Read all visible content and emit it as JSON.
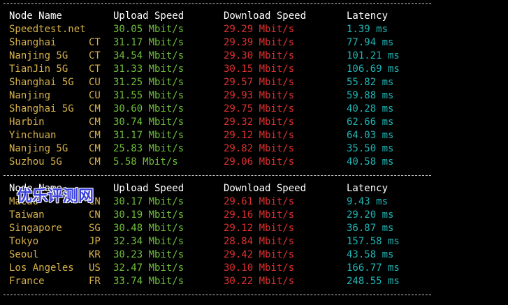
{
  "headers": {
    "name": "Node Name",
    "upload": "Upload Speed",
    "download": "Download Speed",
    "latency": "Latency"
  },
  "separator": "--------------------------------------------------------------------------------",
  "block1": [
    {
      "name": "Speedtest.net",
      "isp": "",
      "upload": "30.05 Mbit/s",
      "download": "29.29 Mbit/s",
      "latency": "1.39 ms"
    },
    {
      "name": "Shanghai",
      "isp": "CT",
      "upload": "31.17 Mbit/s",
      "download": "29.39 Mbit/s",
      "latency": "77.94 ms"
    },
    {
      "name": "Nanjing 5G",
      "isp": "CT",
      "upload": "34.54 Mbit/s",
      "download": "29.30 Mbit/s",
      "latency": "101.21 ms"
    },
    {
      "name": "TianJin 5G",
      "isp": "CT",
      "upload": "31.33 Mbit/s",
      "download": "30.15 Mbit/s",
      "latency": "106.69 ms"
    },
    {
      "name": "Shanghai 5G",
      "isp": "CU",
      "upload": "31.25 Mbit/s",
      "download": "29.57 Mbit/s",
      "latency": "55.82 ms"
    },
    {
      "name": "Nanjing",
      "isp": "CU",
      "upload": "31.55 Mbit/s",
      "download": "29.93 Mbit/s",
      "latency": "59.88 ms"
    },
    {
      "name": "Shanghai 5G",
      "isp": "CM",
      "upload": "30.60 Mbit/s",
      "download": "29.75 Mbit/s",
      "latency": "40.28 ms"
    },
    {
      "name": "Harbin",
      "isp": "CM",
      "upload": "30.74 Mbit/s",
      "download": "29.32 Mbit/s",
      "latency": "62.66 ms"
    },
    {
      "name": "Yinchuan",
      "isp": "CM",
      "upload": "31.17 Mbit/s",
      "download": "29.12 Mbit/s",
      "latency": "64.03 ms"
    },
    {
      "name": "Nanjing 5G",
      "isp": "CM",
      "upload": "25.83 Mbit/s",
      "download": "29.82 Mbit/s",
      "latency": "35.50 ms"
    },
    {
      "name": "Suzhou 5G",
      "isp": "CM",
      "upload": "5.58 Mbit/s",
      "download": "29.06 Mbit/s",
      "latency": "40.58 ms"
    }
  ],
  "block2": [
    {
      "name": "Macao",
      "isp": "CN",
      "upload": "30.17 Mbit/s",
      "download": "29.61 Mbit/s",
      "latency": "9.43 ms"
    },
    {
      "name": "Taiwan",
      "isp": "CN",
      "upload": "30.19 Mbit/s",
      "download": "29.16 Mbit/s",
      "latency": "29.20 ms"
    },
    {
      "name": "Singapore",
      "isp": "SG",
      "upload": "30.48 Mbit/s",
      "download": "29.12 Mbit/s",
      "latency": "36.87 ms"
    },
    {
      "name": "Tokyo",
      "isp": "JP",
      "upload": "32.34 Mbit/s",
      "download": "28.84 Mbit/s",
      "latency": "157.58 ms"
    },
    {
      "name": "Seoul",
      "isp": "KR",
      "upload": "30.23 Mbit/s",
      "download": "29.42 Mbit/s",
      "latency": "43.58 ms"
    },
    {
      "name": "Los Angeles",
      "isp": "US",
      "upload": "32.47 Mbit/s",
      "download": "30.10 Mbit/s",
      "latency": "166.77 ms"
    },
    {
      "name": "France",
      "isp": "FR",
      "upload": "33.74 Mbit/s",
      "download": "30.22 Mbit/s",
      "latency": "248.55 ms"
    }
  ],
  "watermark": "优乐评测网",
  "colors": {
    "background": "#000000",
    "header": "#ffffff",
    "node_name": "#d7b14a",
    "upload": "#6fbf3a",
    "download": "#e0302f",
    "latency": "#1fb5b5",
    "watermark": "#3a40e0"
  }
}
